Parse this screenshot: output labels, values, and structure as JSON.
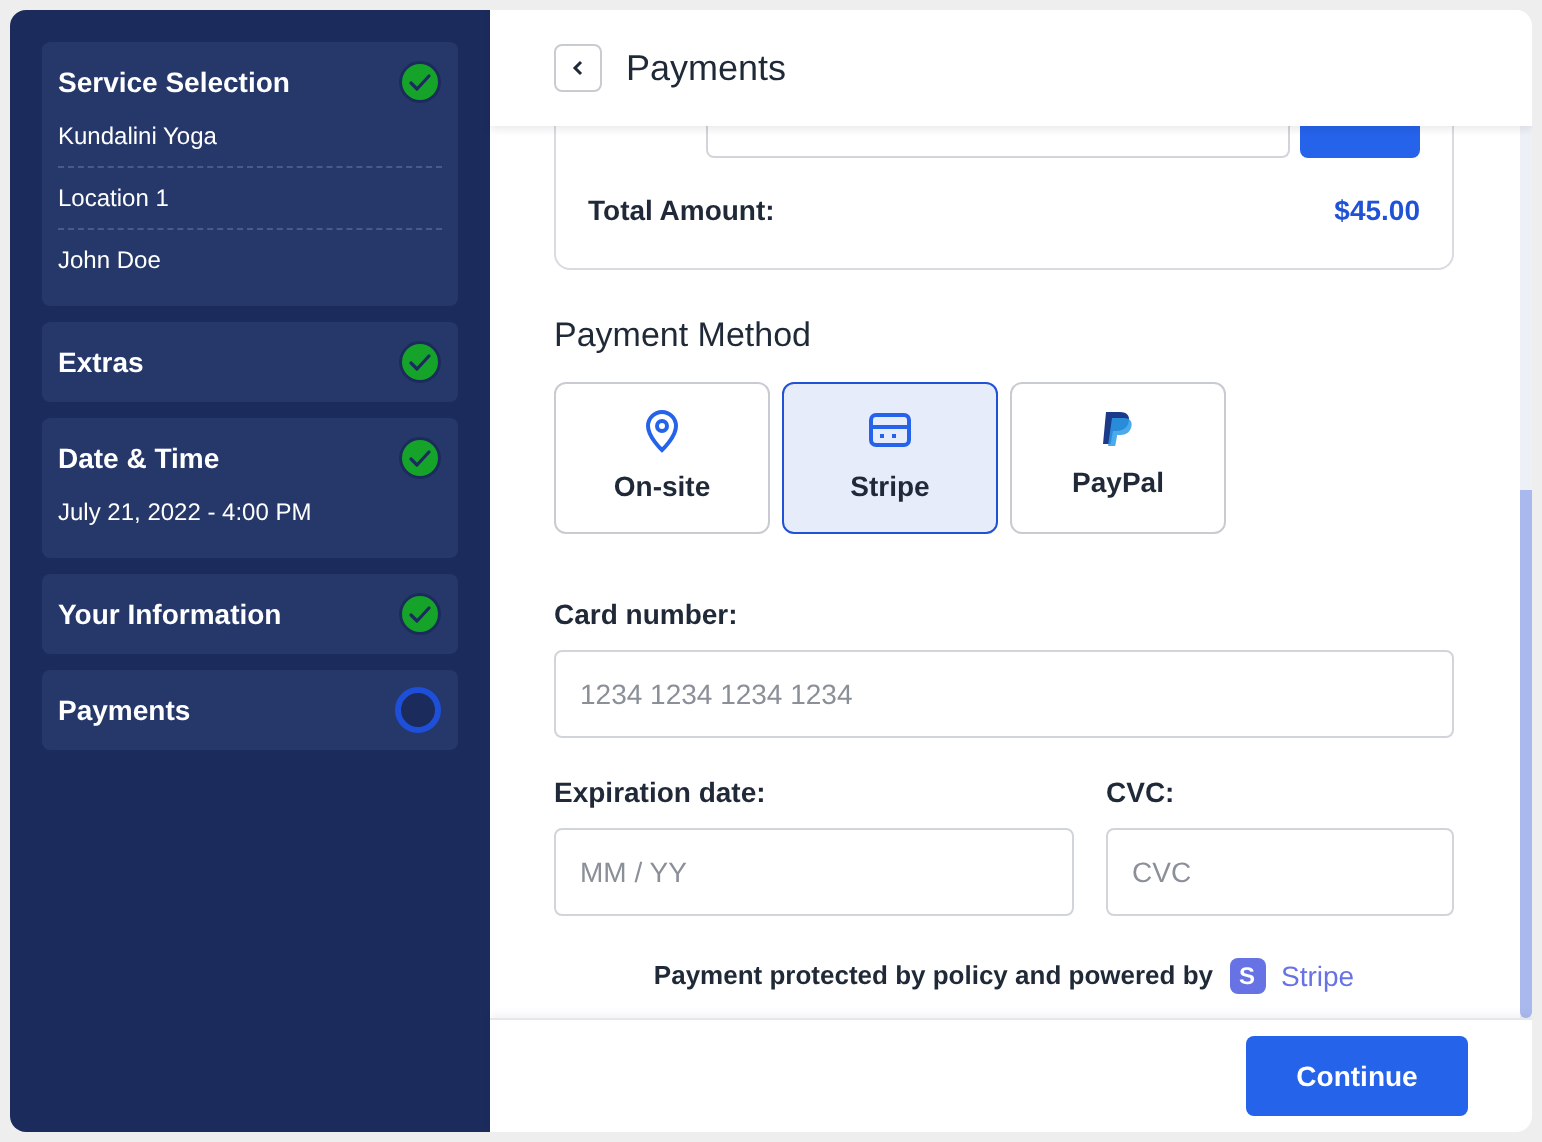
{
  "steps": [
    {
      "title": "Service Selection",
      "completed": true,
      "details": [
        "Kundalini Yoga",
        "Location 1",
        "John Doe"
      ]
    },
    {
      "title": "Extras",
      "completed": true
    },
    {
      "title": "Date & Time",
      "completed": true,
      "details": [
        "July 21, 2022 - 4:00 PM"
      ]
    },
    {
      "title": "Your Information",
      "completed": true
    },
    {
      "title": "Payments",
      "completed": false
    }
  ],
  "header": {
    "title": "Payments"
  },
  "summary": {
    "total_label": "Total Amount:",
    "total_value": "$45.00"
  },
  "payment_method": {
    "heading": "Payment Method",
    "options": [
      {
        "label": "On-site",
        "kind": "onsite",
        "selected": false
      },
      {
        "label": "Stripe",
        "kind": "stripe",
        "selected": true
      },
      {
        "label": "PayPal",
        "kind": "paypal",
        "selected": false
      }
    ]
  },
  "card": {
    "number_label": "Card number:",
    "number_placeholder": "1234 1234 1234 1234",
    "expiry_label": "Expiration date:",
    "expiry_placeholder": "MM / YY",
    "cvc_label": "CVC:",
    "cvc_placeholder": "CVC"
  },
  "footer_note": {
    "text": "Payment protected by policy and powered by",
    "badge": "S",
    "brand": "Stripe"
  },
  "continue_button": "Continue"
}
